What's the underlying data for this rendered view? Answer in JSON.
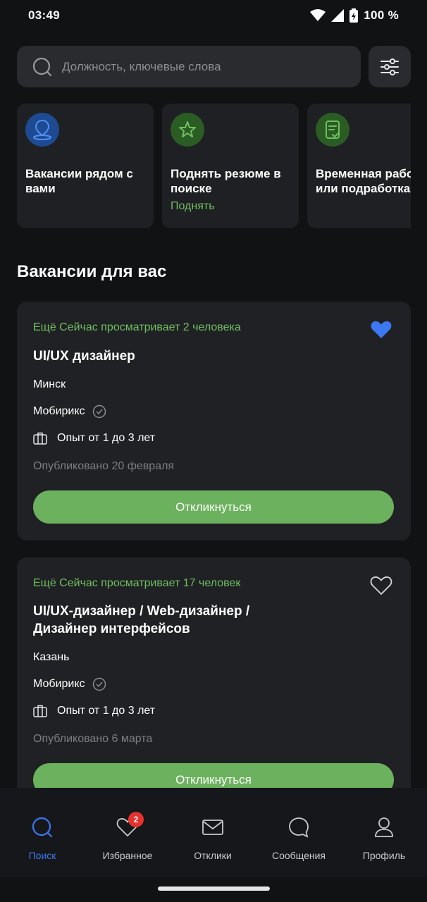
{
  "status": {
    "time": "03:49",
    "battery": "100 %"
  },
  "search": {
    "placeholder": "Должность, ключевые слова"
  },
  "quick_cards": [
    {
      "title": "Вакансии рядом с\nвами",
      "action": "",
      "icon": "location-pin-icon",
      "color": "#1d4a91"
    },
    {
      "title": "Поднять резюме в\nпоиске",
      "action": "Поднять",
      "icon": "star-icon",
      "color": "#2a5c24"
    },
    {
      "title": "Временная работа\nили подработка",
      "action": "",
      "icon": "document-check-icon",
      "color": "#2a5c24"
    }
  ],
  "section": {
    "title": "Вакансии для вас"
  },
  "vacancies": [
    {
      "viewing": "Ещё Сейчас просматривает 2 человека",
      "title": "UI/UX дизайнер",
      "city": "Минск",
      "company": "Мобирикс",
      "experience": "Опыт от 1 до 3 лет",
      "published": "Опубликовано 20 февраля",
      "apply": "Откликнуться",
      "favorite": true
    },
    {
      "viewing": "Ещё Сейчас просматривает 17 человек",
      "title": "UI/UX-дизайнер / Web-дизайнер /\nДизайнер интерфейсов",
      "city": "Казань",
      "company": "Мобирикс",
      "experience": "Опыт от 1 до 3 лет",
      "published": "Опубликовано 6 марта",
      "apply": "Откликнуться",
      "favorite": false
    }
  ],
  "nav": {
    "items": [
      {
        "label": "Поиск",
        "icon": "search-icon",
        "active": true
      },
      {
        "label": "Избранное",
        "icon": "heart-icon",
        "badge": "2"
      },
      {
        "label": "Отклики",
        "icon": "envelope-icon"
      },
      {
        "label": "Сообщения",
        "icon": "chat-bubble-icon"
      },
      {
        "label": "Профиль",
        "icon": "person-icon"
      }
    ]
  },
  "colors": {
    "accent_green": "#6cb25e",
    "accent_blue": "#3b78f2",
    "badge_red": "#e5322f"
  }
}
